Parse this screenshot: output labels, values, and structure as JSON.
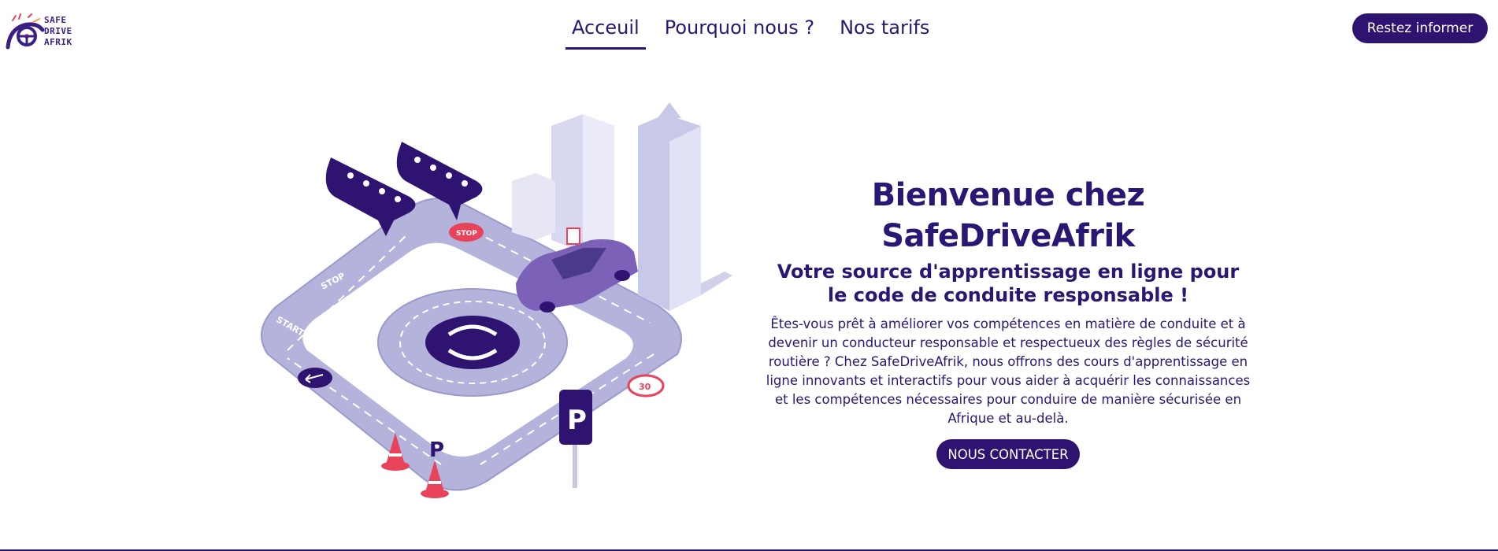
{
  "brand": {
    "logo_lines": [
      "SAFE",
      "DRIVE",
      "AFRIK"
    ]
  },
  "nav": {
    "items": [
      {
        "label": "Acceuil",
        "active": true
      },
      {
        "label": "Pourquoi nous ?",
        "active": false
      },
      {
        "label": "Nos tarifs",
        "active": false
      }
    ]
  },
  "header": {
    "cta_label": "Restez informer"
  },
  "hero": {
    "title": "Bienvenue chez SafeDriveAfrik",
    "subtitle": "Votre source d'apprentissage en ligne pour le code de conduite responsable !",
    "body": "Êtes-vous prêt à améliorer vos compétences en matière de conduite et à devenir un conducteur responsable et respectueux des règles de sécurité routière ? Chez SafeDriveAfrik, nous offrons des cours d'apprentissage en ligne innovants et interactifs pour vous aider à acquérir les connaissances et les compétences nécessaires pour conduire de manière sécurisée en Afrique et au-delà.",
    "cta_label": "NOUS CONTACTER"
  },
  "illustration": {
    "road_labels": [
      "STOP",
      "STOP",
      "START"
    ],
    "sign_labels": [
      "STOP",
      "30",
      "P",
      "P"
    ]
  },
  "colors": {
    "primary": "#2e1470",
    "text": "#2a1673",
    "road": "#b3b3dc",
    "accent_red": "#e8435a"
  }
}
